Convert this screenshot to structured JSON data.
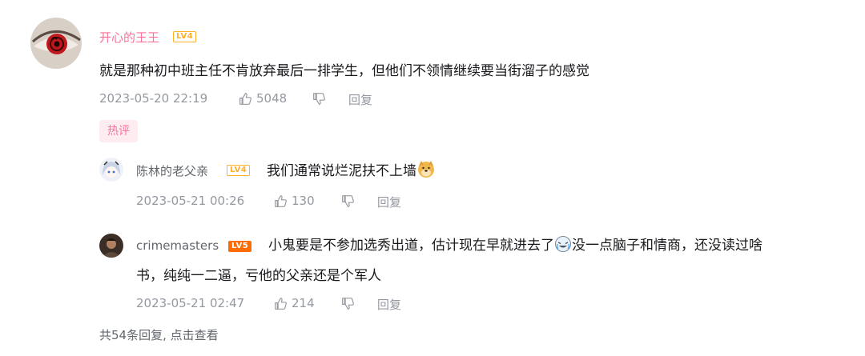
{
  "comment": {
    "username": "开心的王王",
    "level": "LV4",
    "text": "就是那种初中班主任不肯放弃最后一排学生，但他们不领情继续要当街溜子的感觉",
    "time": "2023-05-20 22:19",
    "likes": "5048",
    "reply_label": "回复",
    "tag": "热评"
  },
  "replies": [
    {
      "username": "陈林的老父亲",
      "level": "LV4",
      "text": "我们通常说烂泥扶不上墙",
      "time": "2023-05-21 00:26",
      "likes": "130",
      "reply_label": "回复"
    },
    {
      "username": "crimemasters",
      "level": "LV5",
      "text_part1": "小鬼要是不参加选秀出道，估计现在早就进去了",
      "text_part2": "没一点脑子和情商，还没读过啥",
      "text_line2": "书，纯纯一二逼，亏他的父亲还是个军人",
      "time": "2023-05-21 02:47",
      "likes": "214",
      "reply_label": "回复"
    }
  ],
  "more_replies": "共54条回复, 点击查看",
  "colors": {
    "username_vip": "#fb7299",
    "meta": "#9499a0",
    "lv4": "#ffb027",
    "lv5": "#ff6c00"
  }
}
